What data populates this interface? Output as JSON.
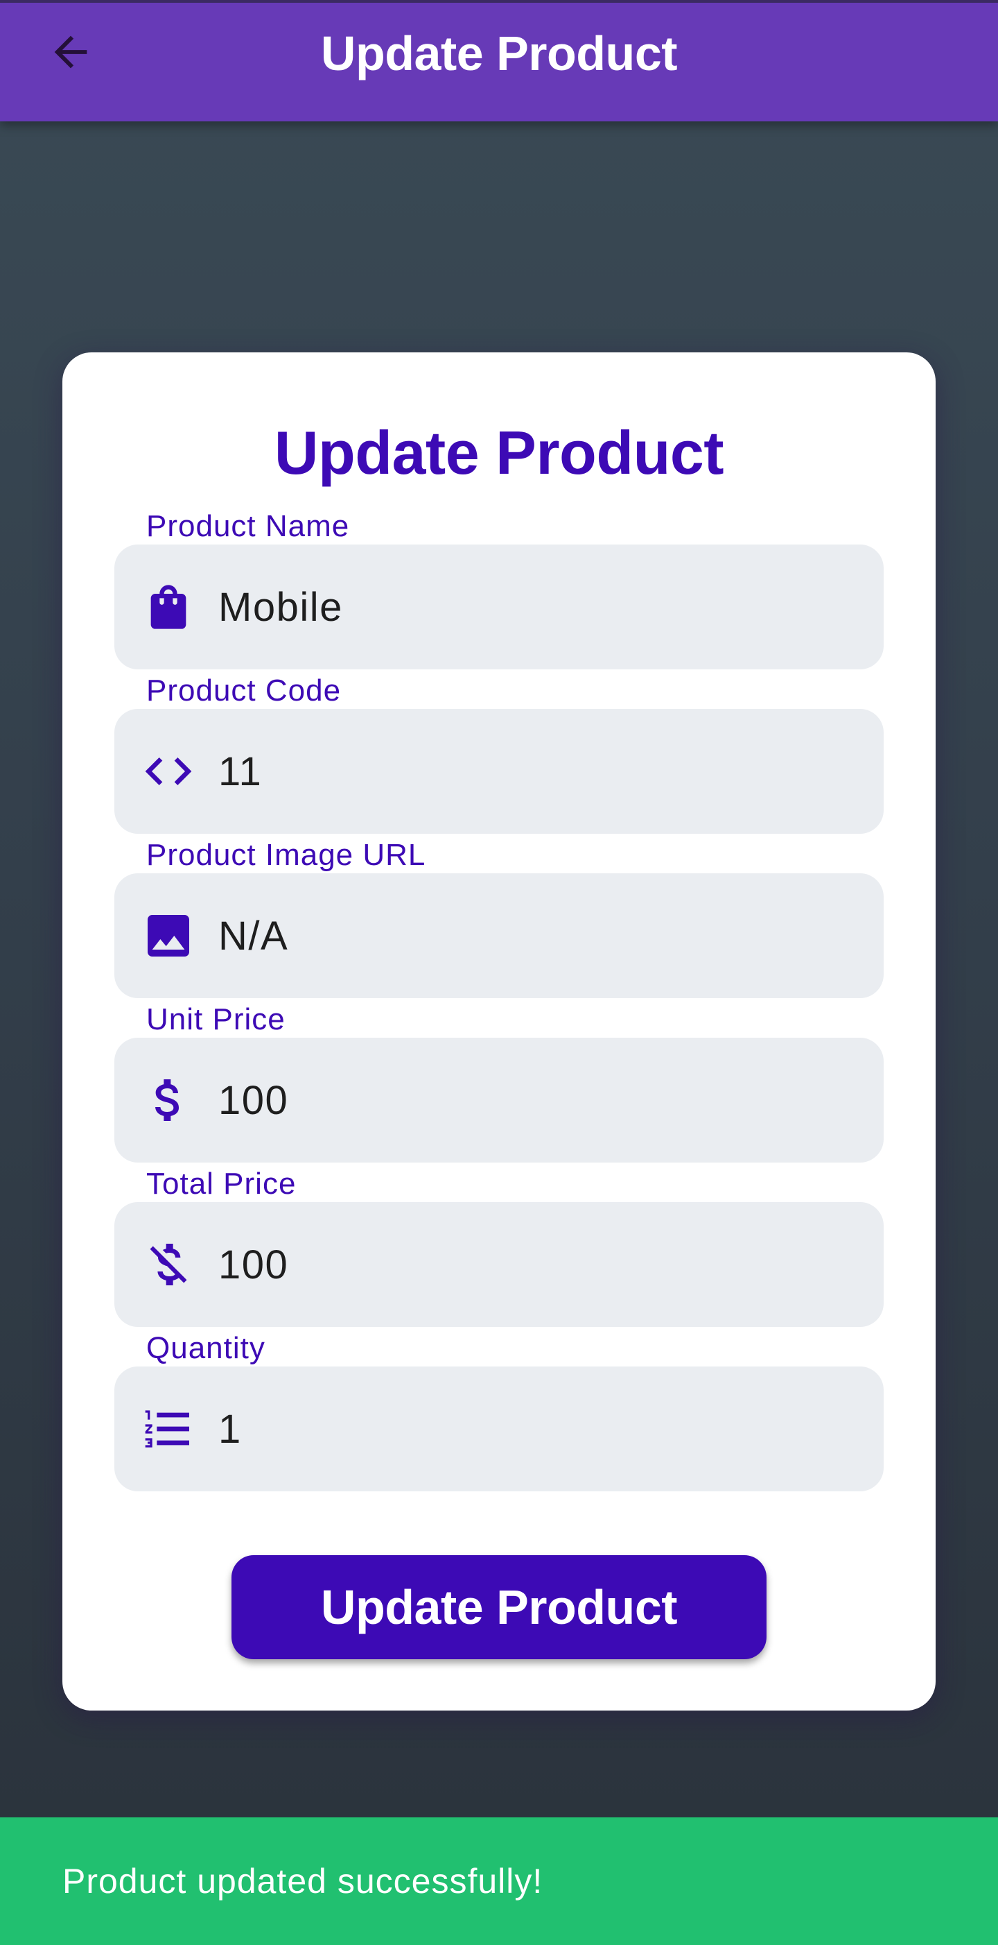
{
  "app_bar": {
    "title": "Update Product",
    "back_icon": "arrow-left-icon",
    "color": "#673ab7"
  },
  "form": {
    "title": "Update Product",
    "fields": [
      {
        "label": "Product Name",
        "value": "Mobile",
        "icon": "shopping-bag-icon"
      },
      {
        "label": "Product Code",
        "value": "11",
        "icon": "code-icon"
      },
      {
        "label": "Product Image URL",
        "value": "N/A",
        "icon": "image-icon"
      },
      {
        "label": "Unit Price",
        "value": "100",
        "icon": "dollar-icon"
      },
      {
        "label": "Total Price",
        "value": "100",
        "icon": "money-off-icon"
      },
      {
        "label": "Quantity",
        "value": "1",
        "icon": "numbered-list-icon"
      }
    ],
    "submit_label": "Update Product",
    "accent_color": "#3d0ab5"
  },
  "snackbar": {
    "message": "Product updated successfully!",
    "color": "#21c070"
  }
}
